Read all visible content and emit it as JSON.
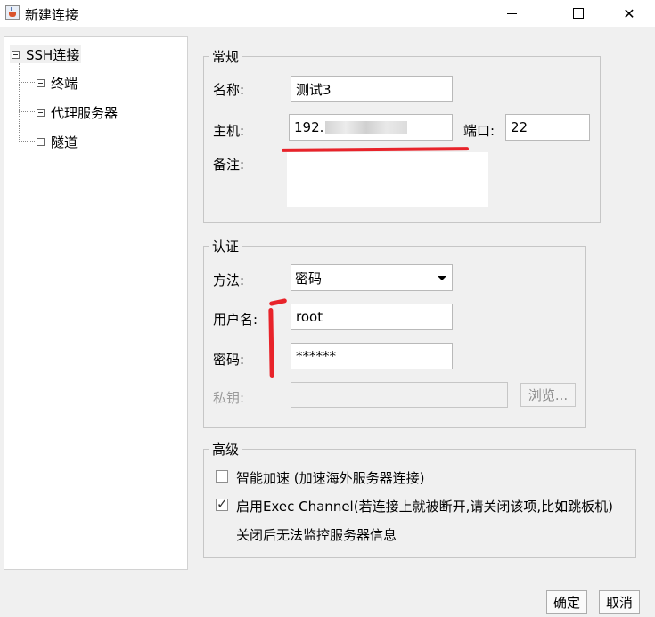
{
  "window": {
    "title": "新建连接",
    "minimize_glyph": "",
    "close_glyph": "✕"
  },
  "tree": {
    "root": "SSH连接",
    "items": [
      "终端",
      "代理服务器",
      "隧道"
    ]
  },
  "general": {
    "title": "常规",
    "name_label": "名称:",
    "name_value": "测试3",
    "host_label": "主机:",
    "host_value": "192.",
    "port_label": "端口:",
    "port_value": "22",
    "notes_label": "备注:"
  },
  "auth": {
    "title": "认证",
    "method_label": "方法:",
    "method_value": "密码",
    "username_label": "用户名:",
    "username_value": "root",
    "password_label": "密码:",
    "password_value": "******",
    "private_key_label": "私钥:",
    "browse_label": "浏览..."
  },
  "advanced": {
    "title": "高级",
    "smart_accel_label": "智能加速 (加速海外服务器连接)",
    "smart_accel_checked": false,
    "exec_channel_label": "启用Exec Channel(若连接上就被断开,请关闭该项,比如跳板机)",
    "exec_channel_checked": true,
    "exec_channel_note": "关闭后无法监控服务器信息",
    "check_glyph": "✓"
  },
  "footer": {
    "ok_label": "确定",
    "cancel_label": "取消"
  },
  "colors": {
    "annotation": "#e8232a",
    "window_bg": "#f0f0f0"
  }
}
